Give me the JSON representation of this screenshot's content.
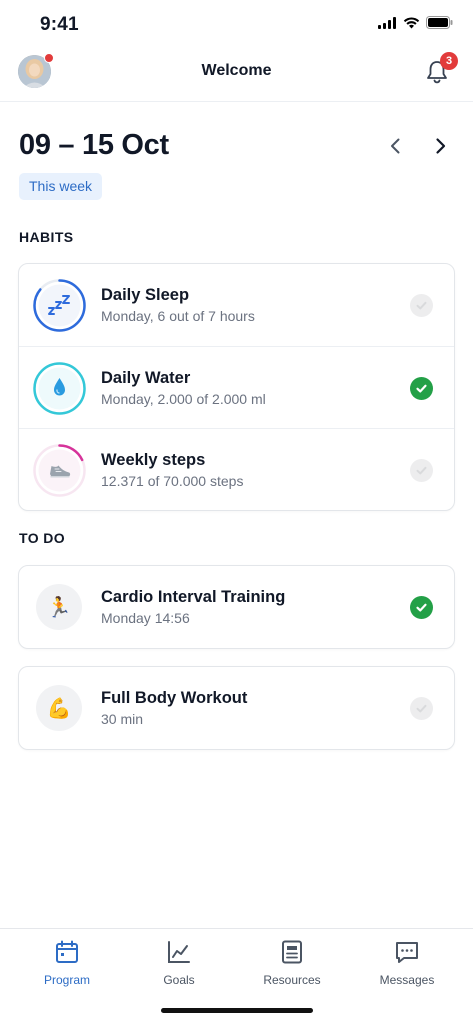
{
  "status_bar": {
    "time": "9:41"
  },
  "header": {
    "title": "Welcome",
    "notification_count": "3"
  },
  "week": {
    "range": "09 – 15 Oct",
    "chip": "This week"
  },
  "habits": {
    "label": "HABITS",
    "items": [
      {
        "title": "Daily Sleep",
        "subtitle": "Monday, 6 out of 7 hours",
        "icon": "sleep-icon",
        "progress": 0.86,
        "color": "#2e6bdc",
        "done": false
      },
      {
        "title": "Daily Water",
        "subtitle": "Monday, 2.000 of 2.000 ml",
        "icon": "water-drop-icon",
        "progress": 1.0,
        "color": "#34c8d8",
        "done": true
      },
      {
        "title": "Weekly steps",
        "subtitle": "12.371 of 70.000 steps",
        "icon": "sneaker-icon",
        "progress": 0.18,
        "color": "#d6339a",
        "done": false
      }
    ]
  },
  "todo": {
    "label": "TO DO",
    "items": [
      {
        "title": "Cardio Interval Training",
        "subtitle": "Monday 14:56",
        "icon": "running-person-icon",
        "emoji": "🏃",
        "done": true
      },
      {
        "title": "Full Body Workout",
        "subtitle": "30 min",
        "icon": "flexed-biceps-icon",
        "emoji": "💪",
        "done": false
      }
    ]
  },
  "tabbar": {
    "tabs": [
      {
        "label": "Program",
        "icon": "calendar-icon",
        "active": true
      },
      {
        "label": "Goals",
        "icon": "chart-line-icon",
        "active": false
      },
      {
        "label": "Resources",
        "icon": "document-icon",
        "active": false
      },
      {
        "label": "Messages",
        "icon": "chat-icon",
        "active": false
      }
    ]
  },
  "colors": {
    "accent": "#2d6cc5",
    "success": "#23a047",
    "badge": "#e23b3b"
  }
}
